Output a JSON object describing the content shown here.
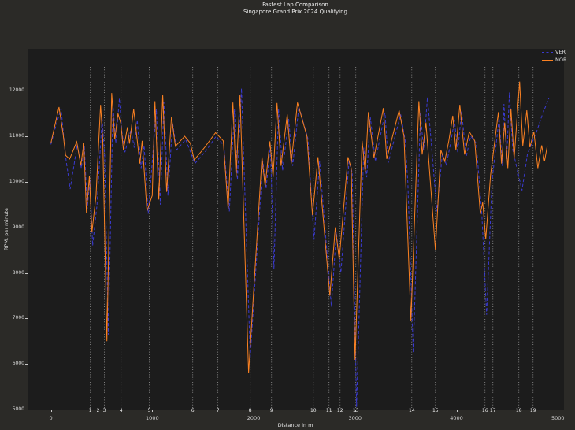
{
  "title": {
    "line1": "Fastest Lap Comparison",
    "line2": "Singapore Grand Prix 2024 Qualifying"
  },
  "axes": {
    "xlabel": "Distance in m",
    "ylabel": "RPM, per minute",
    "x_tick_labels": [
      "0",
      "1000",
      "2000",
      "3000",
      "4000",
      "5000"
    ],
    "y_tick_labels": [
      "5000",
      "6000",
      "7000",
      "8000",
      "9000",
      "10000",
      "11000",
      "12000"
    ]
  },
  "legend": {
    "items": [
      {
        "label": "VER",
        "color": "#3a3ad0",
        "linestyle": "dashed"
      },
      {
        "label": "NOR",
        "color": "#fb8122",
        "linestyle": "solid"
      }
    ]
  },
  "colors": {
    "figure_background": "#2b2a27",
    "plot_background": "#1c1c1c",
    "corner_line": "#9a9a9a",
    "text": "#e9e9e9",
    "ver_blue": "#3a3ad0",
    "nor_orange": "#fb8122"
  },
  "chart_data": {
    "type": "line",
    "title": "Fastest Lap Comparison — Singapore Grand Prix 2024 Qualifying",
    "xlabel": "Distance in m",
    "ylabel": "RPM, per minute",
    "xlim": [
      -230,
      5060
    ],
    "ylim": [
      5000,
      12920
    ],
    "x_ticks": [
      0,
      1000,
      2000,
      3000,
      4000,
      5000
    ],
    "y_ticks": [
      5000,
      6000,
      7000,
      8000,
      9000,
      10000,
      11000,
      12000
    ],
    "grid": false,
    "legend_position": "upper right",
    "corner_markers": {
      "style": "vertical dotted lines with numbers at bottom",
      "numbers": [
        1,
        2,
        3,
        4,
        5,
        6,
        7,
        8,
        9,
        10,
        11,
        12,
        13,
        14,
        15,
        16,
        17,
        18,
        19
      ],
      "positions_m": [
        389,
        466,
        528,
        692,
        971,
        1399,
        1647,
        1966,
        2176,
        2588,
        2743,
        2852,
        3007,
        3559,
        3792,
        4281,
        4359,
        4615,
        4755
      ]
    },
    "series": [
      {
        "name": "VER",
        "color": "#3a3ad0",
        "linestyle": "dashed",
        "points": [
          [
            0,
            10820
          ],
          [
            45,
            11200
          ],
          [
            100,
            11610
          ],
          [
            145,
            10550
          ],
          [
            190,
            9840
          ],
          [
            260,
            10820
          ],
          [
            300,
            10300
          ],
          [
            330,
            10780
          ],
          [
            358,
            9400
          ],
          [
            385,
            10050
          ],
          [
            412,
            8600
          ],
          [
            455,
            9500
          ],
          [
            505,
            11400
          ],
          [
            530,
            10600
          ],
          [
            567,
            6640
          ],
          [
            612,
            11700
          ],
          [
            640,
            10850
          ],
          [
            676,
            11830
          ],
          [
            700,
            11100
          ],
          [
            730,
            10650
          ],
          [
            790,
            11150
          ],
          [
            822,
            10750
          ],
          [
            852,
            11350
          ],
          [
            890,
            10300
          ],
          [
            920,
            10800
          ],
          [
            960,
            9300
          ],
          [
            1040,
            11600
          ],
          [
            1080,
            9500
          ],
          [
            1115,
            11750
          ],
          [
            1155,
            9700
          ],
          [
            1200,
            11300
          ],
          [
            1240,
            10700
          ],
          [
            1330,
            10930
          ],
          [
            1420,
            10400
          ],
          [
            1530,
            10680
          ],
          [
            1630,
            11000
          ],
          [
            1705,
            10800
          ],
          [
            1760,
            9350
          ],
          [
            1810,
            11600
          ],
          [
            1840,
            10050
          ],
          [
            1880,
            12050
          ],
          [
            1966,
            6150
          ],
          [
            2090,
            10450
          ],
          [
            2122,
            9850
          ],
          [
            2165,
            10800
          ],
          [
            2200,
            8080
          ],
          [
            2245,
            11600
          ],
          [
            2285,
            10250
          ],
          [
            2345,
            11380
          ],
          [
            2385,
            10350
          ],
          [
            2445,
            11650
          ],
          [
            2535,
            10950
          ],
          [
            2595,
            8730
          ],
          [
            2650,
            10450
          ],
          [
            2766,
            7260
          ],
          [
            2815,
            8900
          ],
          [
            2860,
            8000
          ],
          [
            2940,
            10450
          ],
          [
            2972,
            10200
          ],
          [
            3015,
            5050
          ],
          [
            3085,
            10750
          ],
          [
            3115,
            10100
          ],
          [
            3150,
            11430
          ],
          [
            3200,
            10450
          ],
          [
            3295,
            11520
          ],
          [
            3327,
            10420
          ],
          [
            3450,
            11480
          ],
          [
            3495,
            10900
          ],
          [
            3520,
            9980
          ],
          [
            3574,
            6250
          ],
          [
            3645,
            11500
          ],
          [
            3676,
            10700
          ],
          [
            3714,
            11860
          ],
          [
            3807,
            9350
          ],
          [
            3860,
            10600
          ],
          [
            3900,
            10380
          ],
          [
            3940,
            10820
          ],
          [
            3980,
            11350
          ],
          [
            4012,
            10650
          ],
          [
            4050,
            11560
          ],
          [
            4095,
            10550
          ],
          [
            4140,
            11000
          ],
          [
            4195,
            10850
          ],
          [
            4250,
            9300
          ],
          [
            4297,
            7080
          ],
          [
            4350,
            10000
          ],
          [
            4420,
            11400
          ],
          [
            4452,
            10350
          ],
          [
            4468,
            11710
          ],
          [
            4495,
            10500
          ],
          [
            4522,
            11960
          ],
          [
            4555,
            10700
          ],
          [
            4646,
            9810
          ],
          [
            4700,
            10620
          ],
          [
            4790,
            11100
          ],
          [
            4850,
            11500
          ],
          [
            4911,
            11830
          ]
        ]
      },
      {
        "name": "NOR",
        "color": "#fb8122",
        "linestyle": "solid",
        "points": [
          [
            0,
            10850
          ],
          [
            40,
            11250
          ],
          [
            80,
            11640
          ],
          [
            120,
            11050
          ],
          [
            145,
            10580
          ],
          [
            185,
            10500
          ],
          [
            255,
            10880
          ],
          [
            295,
            10360
          ],
          [
            325,
            10850
          ],
          [
            350,
            9320
          ],
          [
            380,
            10130
          ],
          [
            405,
            8890
          ],
          [
            445,
            9700
          ],
          [
            490,
            11690
          ],
          [
            512,
            10900
          ],
          [
            552,
            6500
          ],
          [
            600,
            11950
          ],
          [
            630,
            10930
          ],
          [
            662,
            11500
          ],
          [
            690,
            11280
          ],
          [
            715,
            10700
          ],
          [
            755,
            11200
          ],
          [
            775,
            10840
          ],
          [
            816,
            11600
          ],
          [
            878,
            10400
          ],
          [
            900,
            10900
          ],
          [
            948,
            9360
          ],
          [
            1000,
            9700
          ],
          [
            1026,
            11770
          ],
          [
            1064,
            9610
          ],
          [
            1103,
            11910
          ],
          [
            1142,
            9780
          ],
          [
            1189,
            11430
          ],
          [
            1228,
            10780
          ],
          [
            1320,
            11000
          ],
          [
            1375,
            10850
          ],
          [
            1414,
            10480
          ],
          [
            1515,
            10750
          ],
          [
            1624,
            11080
          ],
          [
            1700,
            10900
          ],
          [
            1748,
            9400
          ],
          [
            1795,
            11740
          ],
          [
            1826,
            10100
          ],
          [
            1865,
            11910
          ],
          [
            1950,
            5800
          ],
          [
            2082,
            10540
          ],
          [
            2113,
            9900
          ],
          [
            2160,
            10890
          ],
          [
            2191,
            10100
          ],
          [
            2230,
            11730
          ],
          [
            2270,
            10350
          ],
          [
            2331,
            11480
          ],
          [
            2370,
            10400
          ],
          [
            2432,
            11740
          ],
          [
            2525,
            11000
          ],
          [
            2580,
            9270
          ],
          [
            2634,
            10540
          ],
          [
            2751,
            7500
          ],
          [
            2805,
            9000
          ],
          [
            2844,
            8300
          ],
          [
            2930,
            10540
          ],
          [
            2962,
            10300
          ],
          [
            3000,
            6090
          ],
          [
            3069,
            10900
          ],
          [
            3100,
            10200
          ],
          [
            3131,
            11530
          ],
          [
            3186,
            10530
          ],
          [
            3279,
            11620
          ],
          [
            3312,
            10500
          ],
          [
            3434,
            11570
          ],
          [
            3482,
            11000
          ],
          [
            3551,
            6950
          ],
          [
            3629,
            11770
          ],
          [
            3662,
            10600
          ],
          [
            3699,
            11300
          ],
          [
            3792,
            8500
          ],
          [
            3846,
            10700
          ],
          [
            3885,
            10450
          ],
          [
            3924,
            10900
          ],
          [
            3963,
            11450
          ],
          [
            3994,
            10700
          ],
          [
            4033,
            11690
          ],
          [
            4080,
            10600
          ],
          [
            4126,
            11100
          ],
          [
            4180,
            10900
          ],
          [
            4235,
            9290
          ],
          [
            4258,
            9550
          ],
          [
            4289,
            8740
          ],
          [
            4336,
            10150
          ],
          [
            4413,
            11530
          ],
          [
            4444,
            10400
          ],
          [
            4475,
            11300
          ],
          [
            4506,
            10300
          ],
          [
            4537,
            11600
          ],
          [
            4568,
            10500
          ],
          [
            4623,
            12200
          ],
          [
            4654,
            10790
          ],
          [
            4693,
            11570
          ],
          [
            4724,
            10760
          ],
          [
            4763,
            11100
          ],
          [
            4802,
            10300
          ],
          [
            4840,
            10800
          ],
          [
            4868,
            10450
          ],
          [
            4895,
            10790
          ]
        ]
      }
    ]
  }
}
